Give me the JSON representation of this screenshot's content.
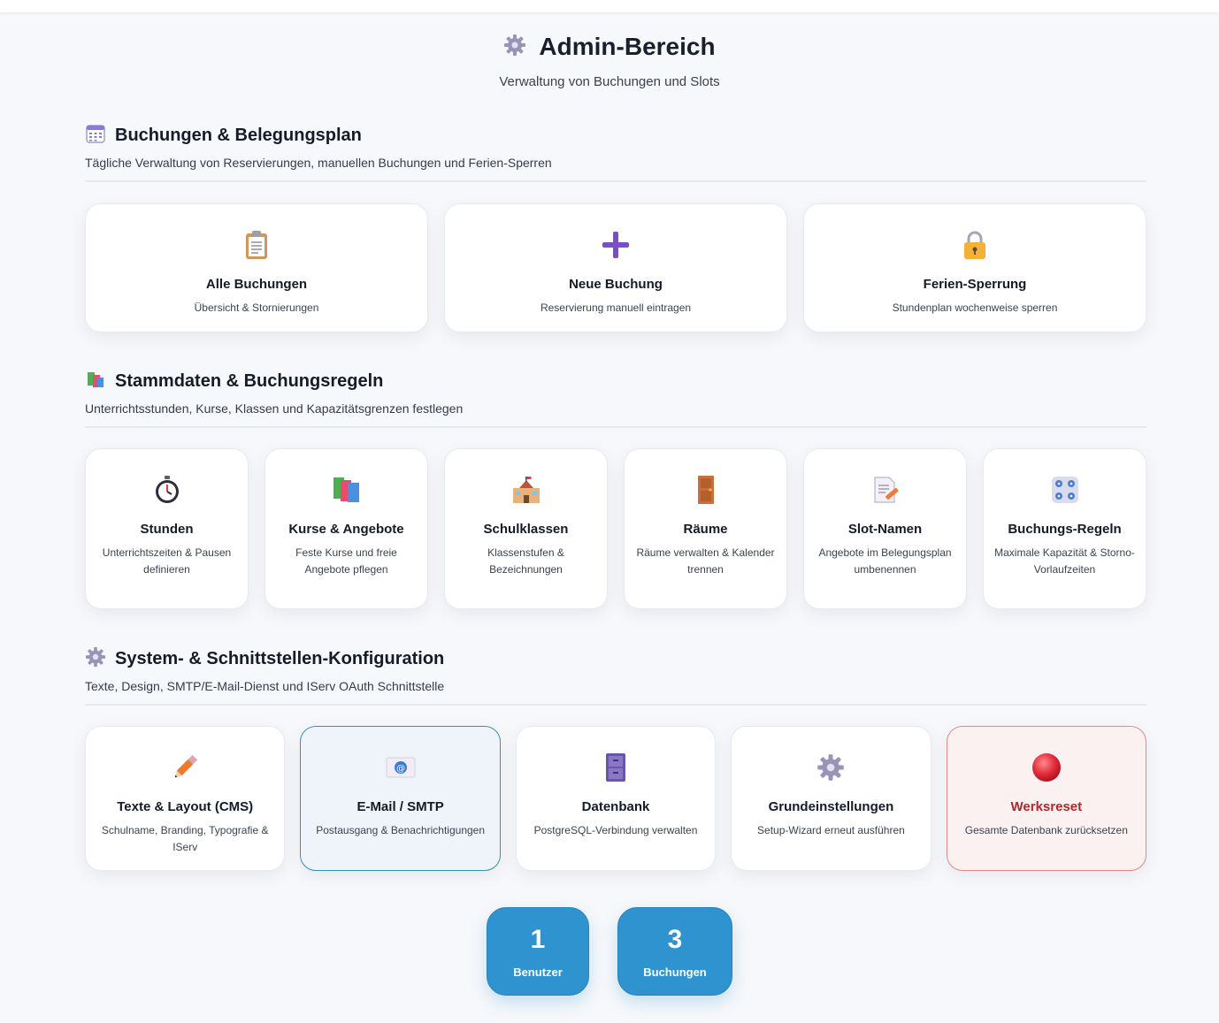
{
  "header": {
    "title": "Admin-Bereich",
    "subtitle": "Verwaltung von Buchungen und Slots",
    "icon": "gear-icon"
  },
  "sections": [
    {
      "title": "Buchungen & Belegungsplan",
      "description": "Tägliche Verwaltung von Reservierungen, manuellen Buchungen und Ferien-Sperren",
      "icon": "calendar-icon",
      "cards": [
        {
          "title": "Alle Buchungen",
          "description": "Übersicht & Stornierungen",
          "icon": "clipboard-icon"
        },
        {
          "title": "Neue Buchung",
          "description": "Reservierung manuell eintragen",
          "icon": "plus-icon"
        },
        {
          "title": "Ferien-Sperrung",
          "description": "Stundenplan wochenweise sperren",
          "icon": "lock-icon"
        }
      ]
    },
    {
      "title": "Stammdaten & Buchungsregeln",
      "description": "Unterrichtsstunden, Kurse, Klassen und Kapazitätsgrenzen festlegen",
      "icon": "books-icon",
      "cards": [
        {
          "title": "Stunden",
          "description": "Unterrichtszeiten & Pausen definieren",
          "icon": "stopwatch-icon"
        },
        {
          "title": "Kurse & Angebote",
          "description": "Feste Kurse und freie Angebote pflegen",
          "icon": "books-icon"
        },
        {
          "title": "Schulklassen",
          "description": "Klassenstufen & Bezeichnungen",
          "icon": "school-icon"
        },
        {
          "title": "Räume",
          "description": "Räume verwalten & Kalender trennen",
          "icon": "door-icon"
        },
        {
          "title": "Slot-Namen",
          "description": "Angebote im Belegungsplan umbenennen",
          "icon": "memo-icon"
        },
        {
          "title": "Buchungs-Regeln",
          "description": "Maximale Kapazität & Storno-Vorlaufzeiten",
          "icon": "control-knobs-icon"
        }
      ]
    },
    {
      "title": "System- & Schnittstellen-Konfiguration",
      "description": "Texte, Design, SMTP/E-Mail-Dienst und IServ OAuth Schnittstelle",
      "icon": "gear-icon",
      "cards": [
        {
          "title": "Texte & Layout (CMS)",
          "description": "Schulname, Branding, Typografie & IServ",
          "icon": "pencil-icon"
        },
        {
          "title": "E-Mail / SMTP",
          "description": "Postausgang & Benachrichtigungen",
          "icon": "email-icon"
        },
        {
          "title": "Datenbank",
          "description": "PostgreSQL-Verbindung verwalten",
          "icon": "file-cabinet-icon"
        },
        {
          "title": "Grundeinstellungen",
          "description": "Setup-Wizard erneut ausführen",
          "icon": "gear-icon"
        },
        {
          "title": "Werksreset",
          "description": "Gesamte Datenbank zurücksetzen",
          "icon": "red-circle-icon"
        }
      ]
    }
  ],
  "stats": [
    {
      "value": "1",
      "label": "Benutzer"
    },
    {
      "value": "3",
      "label": "Buchungen"
    }
  ],
  "colors": {
    "accent": "#2e93cf",
    "danger": "#b3262b",
    "highlight_border": "#3a8fb8"
  }
}
